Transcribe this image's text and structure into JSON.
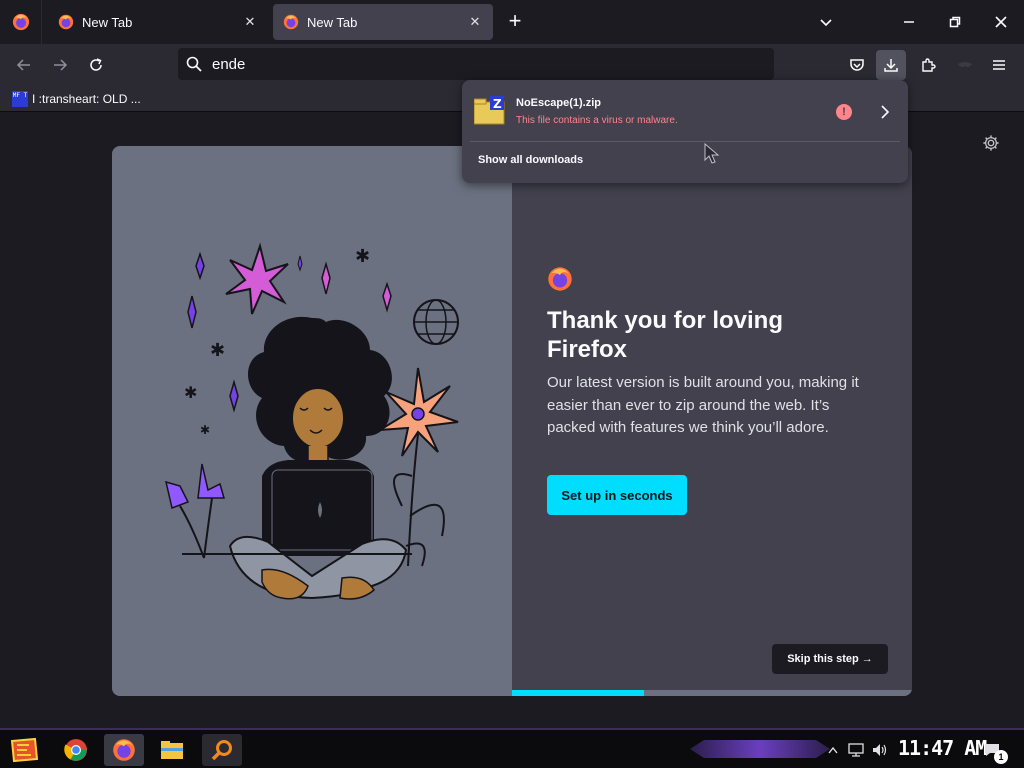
{
  "browser": {
    "tabs": [
      {
        "title": "New Tab",
        "favicon": "firefox-icon",
        "active": false
      },
      {
        "title": "New Tab",
        "favicon": "firefox-icon",
        "active": true
      }
    ],
    "url": "ende",
    "bookmarks": [
      {
        "label": "I :transheart: OLD ...",
        "favicon_text": "MF T"
      }
    ]
  },
  "downloads_panel": {
    "items": [
      {
        "filename": "NoEscape(1).zip",
        "status": "This file contains a virus or malware.",
        "icon": "zip-archive-icon"
      }
    ],
    "show_all_label": "Show all downloads"
  },
  "welcome": {
    "title": "Thank you for loving Firefox",
    "body": "Our latest version is built around you, making it easier than ever to zip around the web. It’s packed with features we think you’ll adore.",
    "cta_label": "Set up in seconds",
    "skip_label": "Skip this step →",
    "progress": 0.33
  },
  "taskbar": {
    "apps": [
      "start-icon",
      "chrome-icon",
      "firefox-icon",
      "file-explorer-icon",
      "search-icon"
    ],
    "clock": "11:47 AM",
    "notification_count": "1"
  },
  "colors": {
    "accent": "#00ddff",
    "warning": "#ff848b",
    "card_left": "#6b7180",
    "panel": "#42414d"
  }
}
